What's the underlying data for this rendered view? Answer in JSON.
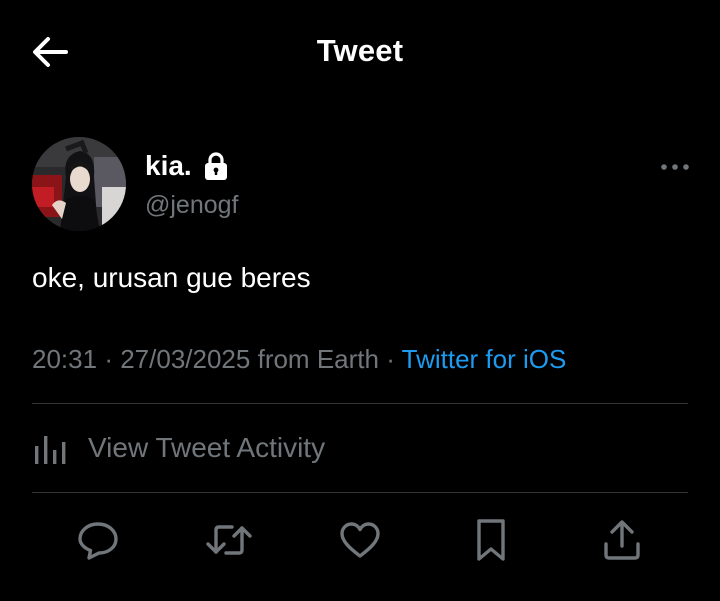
{
  "header": {
    "title": "Tweet",
    "back_icon": "arrow-left-icon"
  },
  "author": {
    "display_name": "kia.",
    "handle": "@jenogf",
    "protected_icon": "lock-icon",
    "avatar": "profile-photo"
  },
  "tweet": {
    "text": "oke, urusan gue beres",
    "time": "20:31",
    "separator": "·",
    "date": "27/03/2025",
    "location": "from Earth",
    "source": "Twitter for iOS"
  },
  "activity": {
    "label": "View Tweet Activity",
    "icon": "analytics-bars-icon"
  },
  "actions": {
    "reply_icon": "reply-bubble-icon",
    "retweet_icon": "retweet-icon",
    "like_icon": "heart-icon",
    "bookmark_icon": "bookmark-icon",
    "share_icon": "share-icon"
  },
  "colors": {
    "background": "#000000",
    "primary_text": "#ffffff",
    "secondary_text": "#71767b",
    "link": "#1d9bf0",
    "divider": "#2f3336"
  }
}
